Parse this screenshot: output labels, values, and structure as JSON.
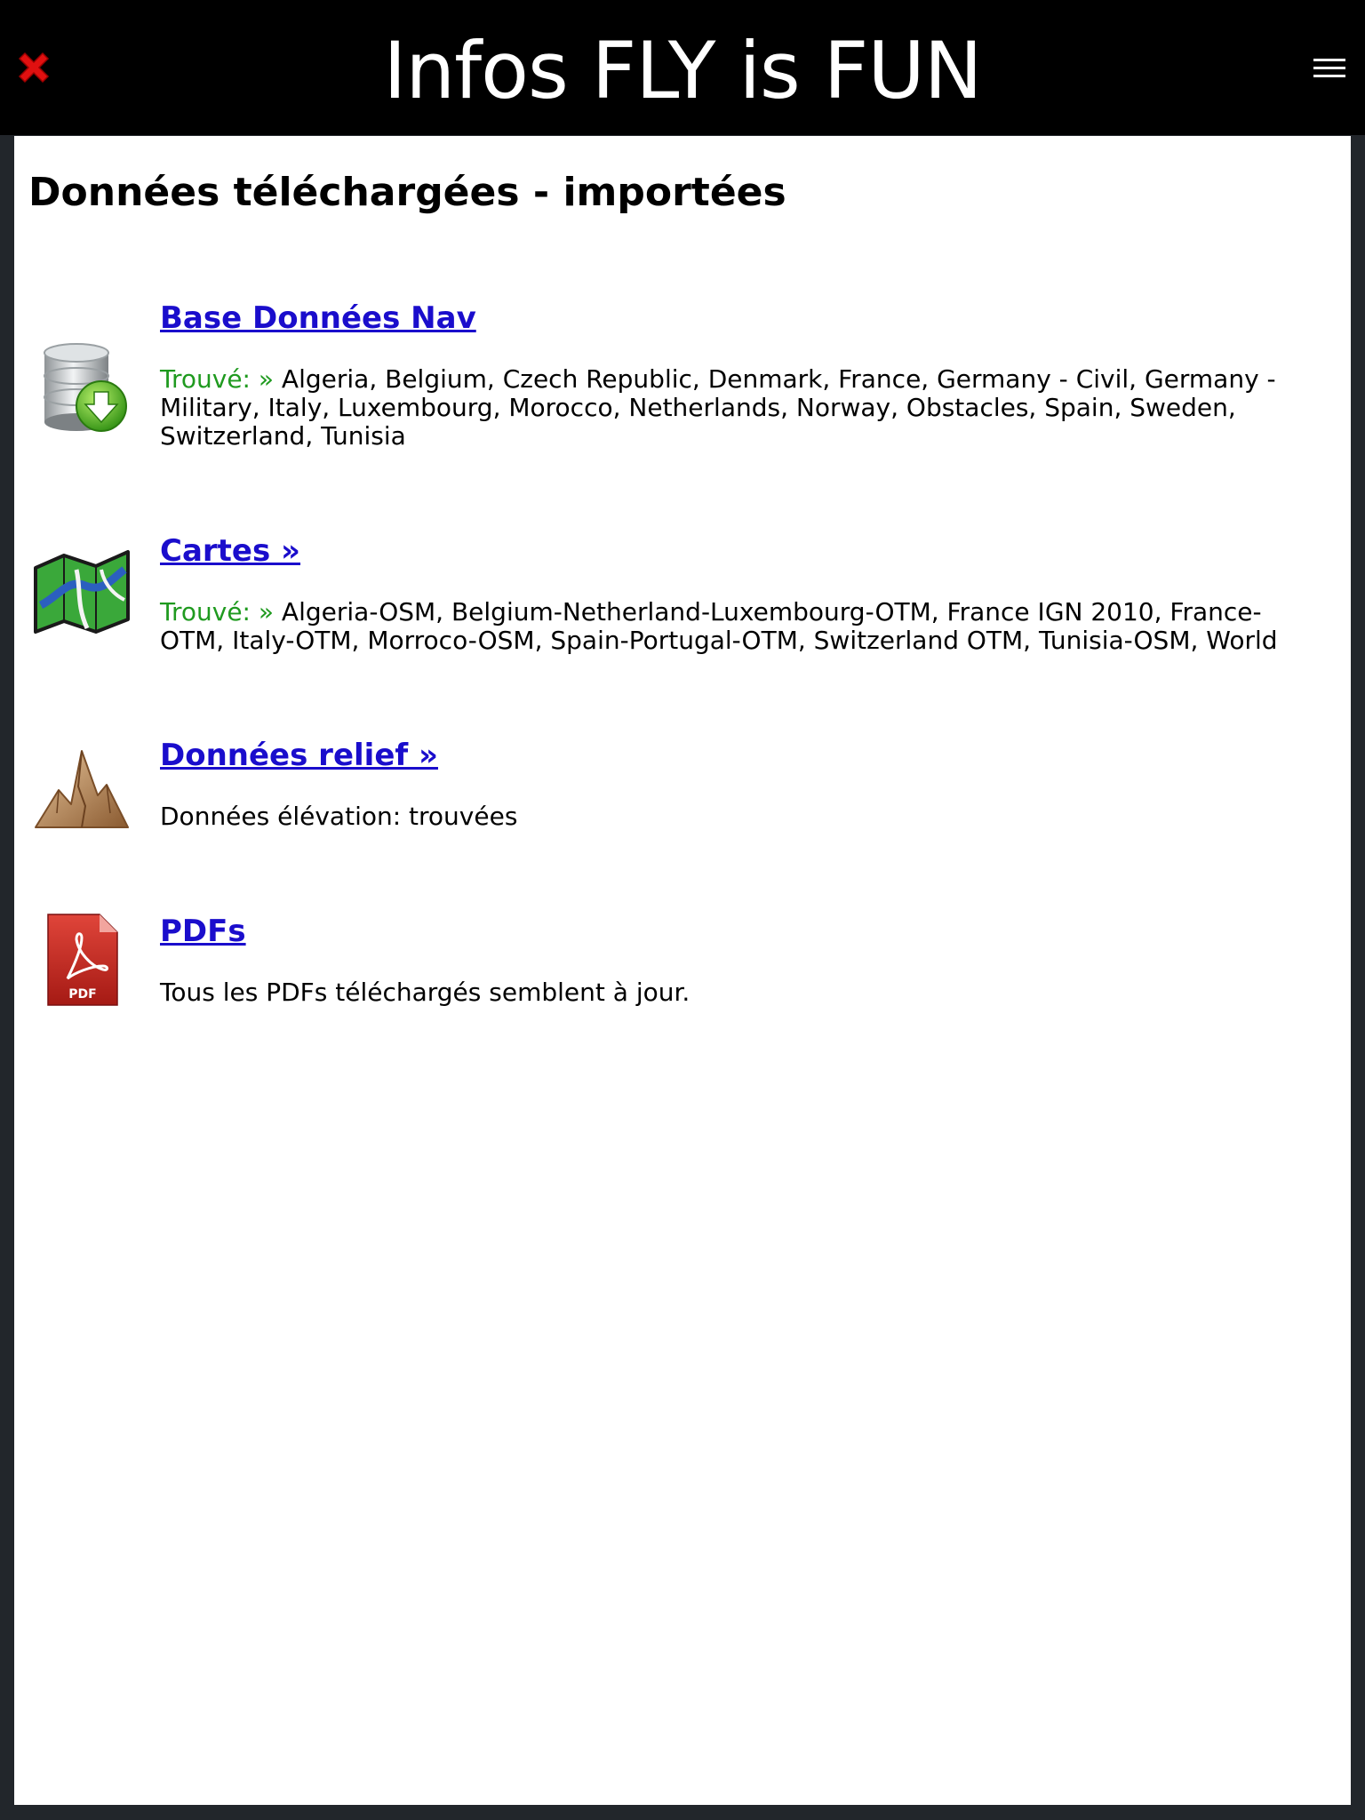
{
  "header": {
    "title": "Infos FLY is FUN",
    "close_icon": "close-icon",
    "menu_icon": "hamburger-menu-icon"
  },
  "page": {
    "title": "Données téléchargées - importées"
  },
  "sections": [
    {
      "icon": "database-download-icon",
      "heading": "Base Données Nav",
      "found_label": "Trouvé: »",
      "found_list": " Algeria, Belgium, Czech Republic, Denmark, France, Germany - Civil, Germany - Military, Italy, Luxembourg, Morocco, Netherlands, Norway, Obstacles, Spain, Sweden, Switzerland, Tunisia"
    },
    {
      "icon": "map-icon",
      "heading": "Cartes »",
      "found_label": "Trouvé: »",
      "found_list": " Algeria-OSM, Belgium-Netherland-Luxembourg-OTM, France IGN 2010, France-OTM, Italy-OTM, Morroco-OSM, Spain-Portugal-OTM, Switzerland OTM, Tunisia-OSM, World"
    },
    {
      "icon": "mountain-relief-icon",
      "heading": "Données relief »",
      "status": "Données élévation: trouvées"
    },
    {
      "icon": "pdf-file-icon",
      "heading": "PDFs",
      "status": "Tous les PDFs téléchargés semblent à jour.",
      "icon_label": "PDF"
    }
  ],
  "colors": {
    "header_bg": "#000000",
    "link": "#1a0dcc",
    "status_green": "#1f9a1f",
    "close_red": "#e01010"
  }
}
